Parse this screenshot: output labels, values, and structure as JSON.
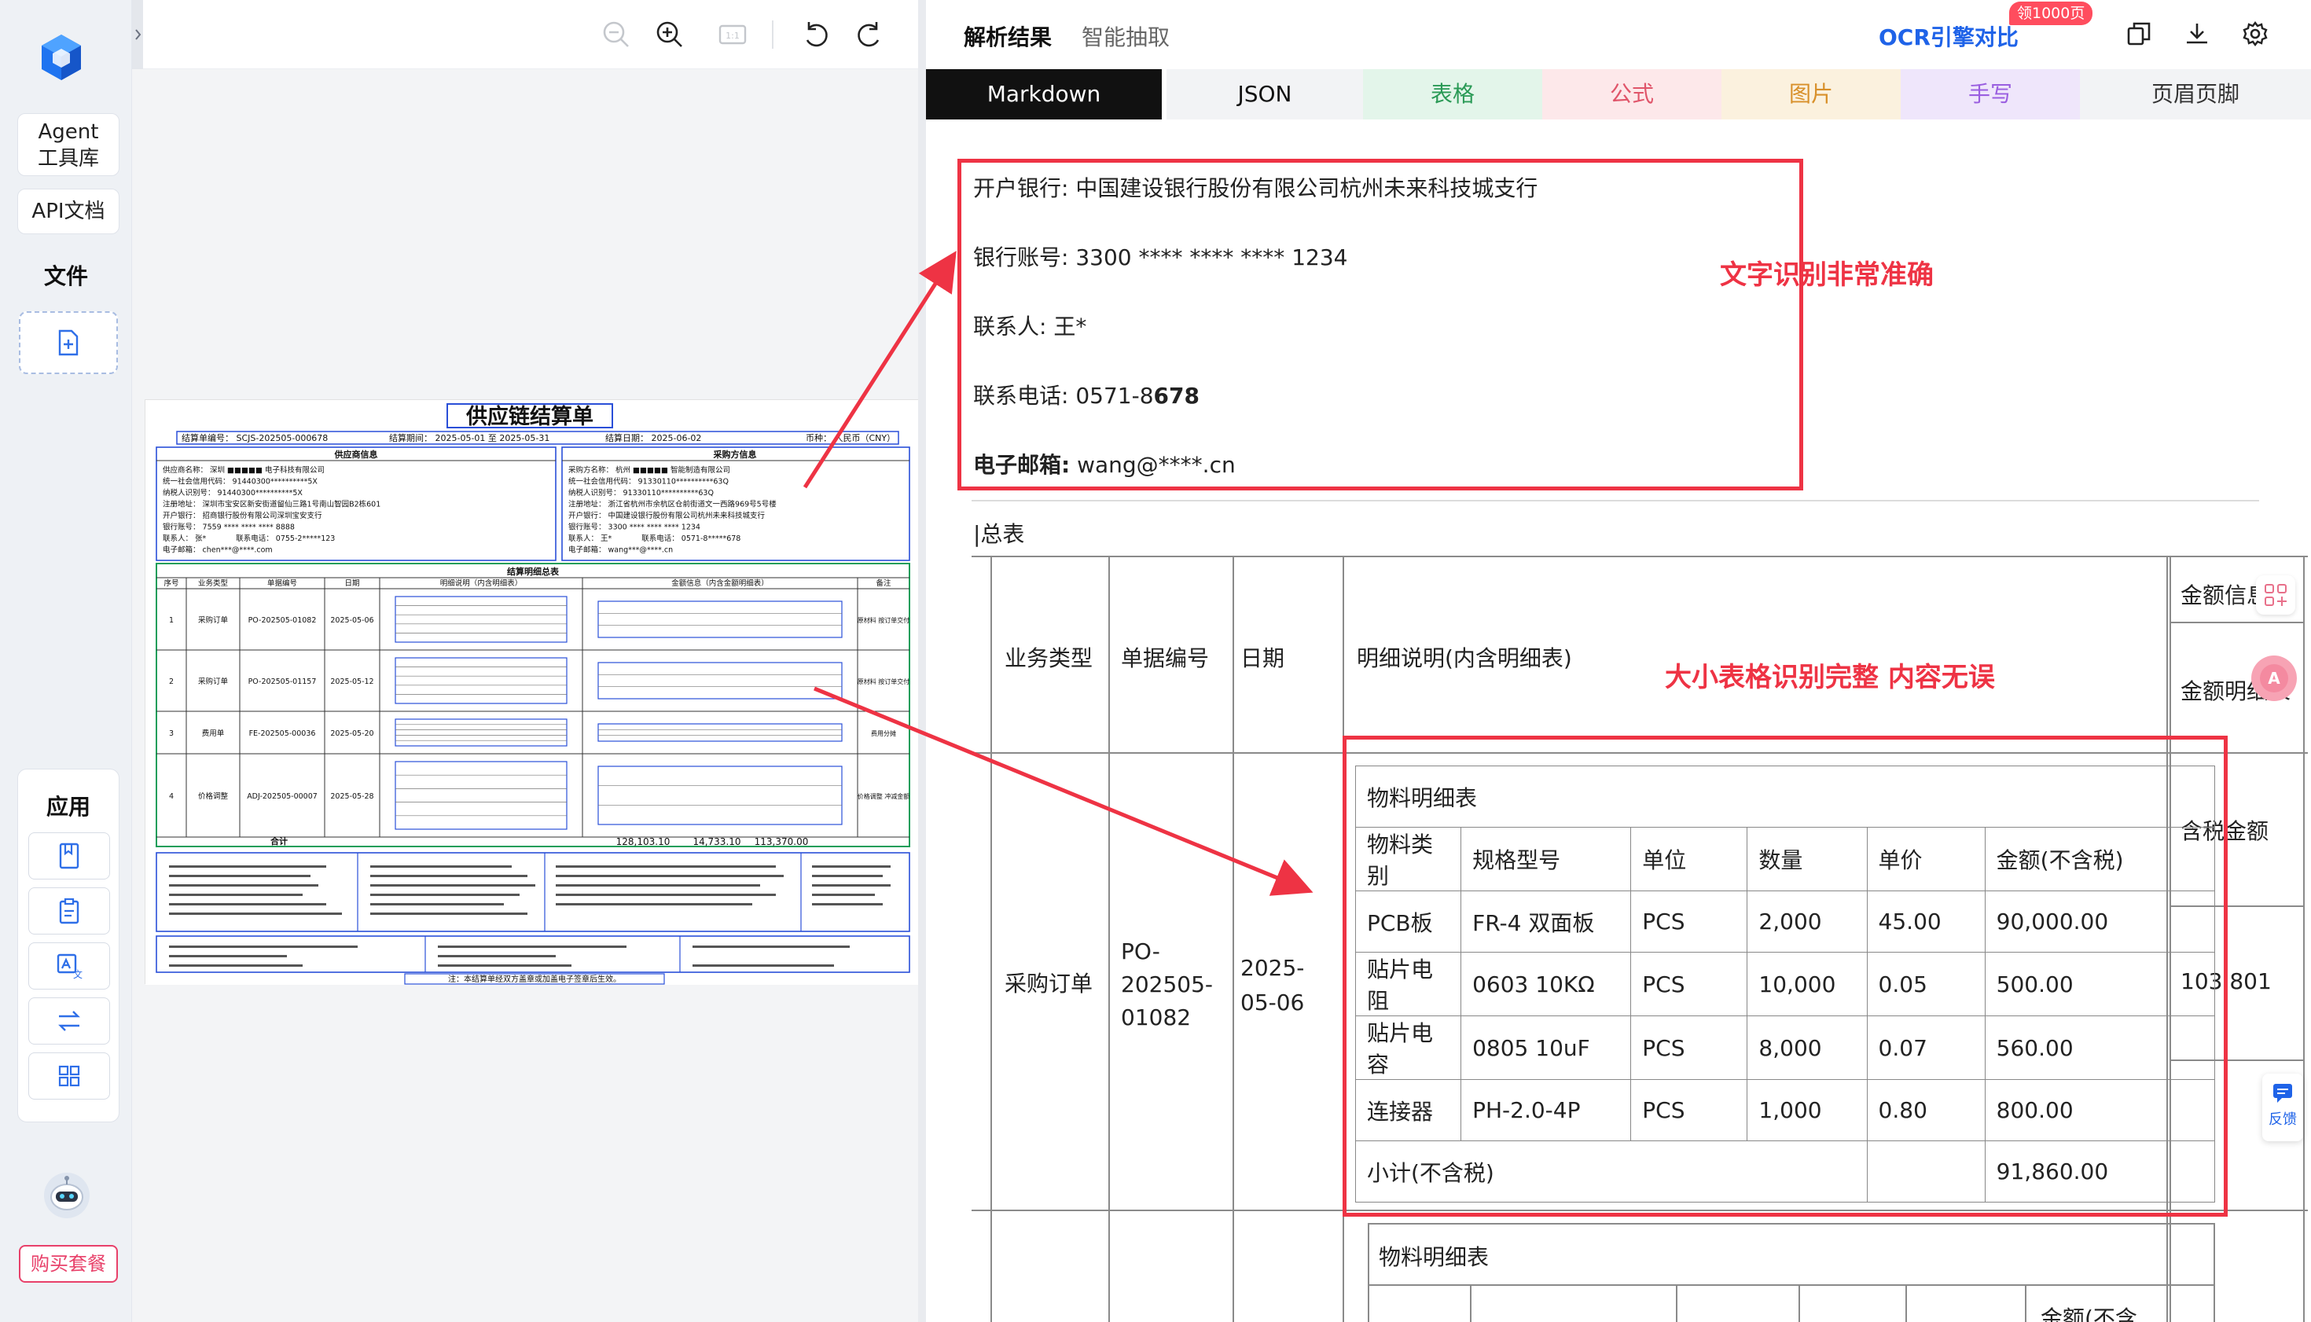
{
  "sidebar": {
    "agent_label": "Agent\n工具库",
    "agent_line1": "Agent",
    "agent_line2": "工具库",
    "api_label": "API文档",
    "files_title": "文件",
    "apps_title": "应用",
    "buy_label": "购买套餐"
  },
  "viewer": {
    "zoom_out": "zoom-out",
    "zoom_in": "zoom-in",
    "one_to_one": "1:1",
    "rotate_left": "rotate-left",
    "rotate_right": "rotate-right"
  },
  "document": {
    "title": "供应链结算单",
    "settle_no": "结算单编号： SCJS-202505-000678",
    "period": "结算期间： 2025-05-01 至 2025-05-31",
    "settle_date": "结算日期： 2025-06-02",
    "currency": "币种： 人民币（CNY）",
    "supplier_title": "供应商信息",
    "buyer_title": "采购方信息",
    "supplier_lines": [
      "供应商名称： 深圳 ■■■■■ 电子科技有限公司",
      "统一社会信用代码： 91440300**********5X",
      "纳税人识别号： 91440300**********5X",
      "注册地址： 深圳市宝安区新安街道留仙三路1号南山智园B2栋601",
      "开户银行： 招商银行股份有限公司深圳宝安支行",
      "银行账号： 7559 **** **** **** 8888",
      "联系人： 张*　　　　联系电话： 0755-2*****123",
      "电子邮箱： chen***@****.com"
    ],
    "buyer_lines": [
      "采购方名称： 杭州 ■■■■■ 智能制造有限公司",
      "统一社会信用代码： 91330110**********63Q",
      "纳税人识别号： 91330110**********63Q",
      "注册地址： 浙江省杭州市余杭区仓前街道文一西路969号5号楼",
      "开户银行： 中国建设银行股份有限公司杭州未来科技城支行",
      "银行账号： 3300 **** **** **** 1234",
      "联系人： 王*　　　　联系电话： 0571-8*****678",
      "电子邮箱： wang***@****.cn"
    ],
    "detail_title": "结算明细总表",
    "detail_headers": [
      "序号",
      "业务类型",
      "单据编号",
      "日期",
      "明细说明（内含明细表）",
      "金额信息（内含金额明细表）",
      "备注"
    ],
    "rows": [
      {
        "no": "1",
        "type": "采购订单",
        "doc": "PO-202505-01082",
        "date": "2025-05-06",
        "note": "原材料 按订单交付"
      },
      {
        "no": "2",
        "type": "采购订单",
        "doc": "PO-202505-01157",
        "date": "2025-05-12",
        "note": "原材料 按订单交付"
      },
      {
        "no": "3",
        "type": "费用单",
        "doc": "FE-202505-00036",
        "date": "2025-05-20",
        "note": "费用分摊"
      },
      {
        "no": "4",
        "type": "价格调整",
        "doc": "ADJ-202505-00007",
        "date": "2025-05-28",
        "note": "价格调整 冲减金额"
      }
    ],
    "total_label": "合计",
    "total_values": [
      "128,103.10",
      "14,733.10",
      "113,370.00"
    ],
    "footer_note": "注：本结算单经双方盖章或加盖电子签章后生效。"
  },
  "tabs": {
    "parse_result": "解析结果",
    "smart_extract": "智能抽取",
    "ocr_compare": "OCR引擎对比",
    "badge": "领1000页"
  },
  "formats": [
    "Markdown",
    "JSON",
    "表格",
    "公式",
    "图片",
    "手写",
    "页眉页脚"
  ],
  "colors": {
    "accent": "#1f63e8",
    "red": "#ee3344",
    "markdown_bg": "#111111",
    "table_tab_bg": "#e3f5ea",
    "formula_tab_bg": "#fde8ea",
    "image_tab_bg": "#fbf1de",
    "handwriting_tab_bg": "#efe6fb",
    "header_tab_bg": "#f2f3f5"
  },
  "result": {
    "bank": "开户银行: 中国建设银行股份有限公司杭州未来科技城支行",
    "account": "银行账号: 3300 **** **** **** 1234",
    "contact": "联系人: 王*",
    "phone_prefix": "联系电话: 0571-8",
    "phone_bold": "678",
    "email_label": "电子邮箱:",
    "email_value": " wang@****.cn",
    "annotation_text": "文字识别非常准确",
    "annotation_table": "大小表格识别完整 内容无误",
    "section_title": "|总表",
    "headers": [
      "业务类型",
      "单据编号",
      "日期",
      "明细说明(内含明细表)",
      "金额信息",
      "金额明细表"
    ],
    "row_type": "采购订单",
    "row_doc_1": "PO-",
    "row_doc_2": "202505-",
    "row_doc_3": "01082",
    "row_date_1": "2025-",
    "row_date_2": "05-06",
    "tax_col": "含税金额",
    "tax_val": "103,801",
    "inner_title": "物料明细表",
    "inner_headers": [
      "物料类别",
      "规格型号",
      "单位",
      "数量",
      "单价",
      "金额(不含税)"
    ],
    "inner_rows": [
      [
        "PCB板",
        "FR-4 双面板",
        "PCS",
        "2,000",
        "45.00",
        "90,000.00"
      ],
      [
        "贴片电阻",
        "0603 10KΩ",
        "PCS",
        "10,000",
        "0.05",
        "500.00"
      ],
      [
        "贴片电容",
        "0805 10uF",
        "PCS",
        "8,000",
        "0.07",
        "560.00"
      ],
      [
        "连接器",
        "PH-2.0-4P",
        "PCS",
        "1,000",
        "0.80",
        "800.00"
      ]
    ],
    "subtotal_label": "小计(不含税)",
    "subtotal_value": "91,860.00",
    "inner_title_2": "物料明细表",
    "amount_partial": "金额(不含"
  },
  "feedback_label": "反馈"
}
